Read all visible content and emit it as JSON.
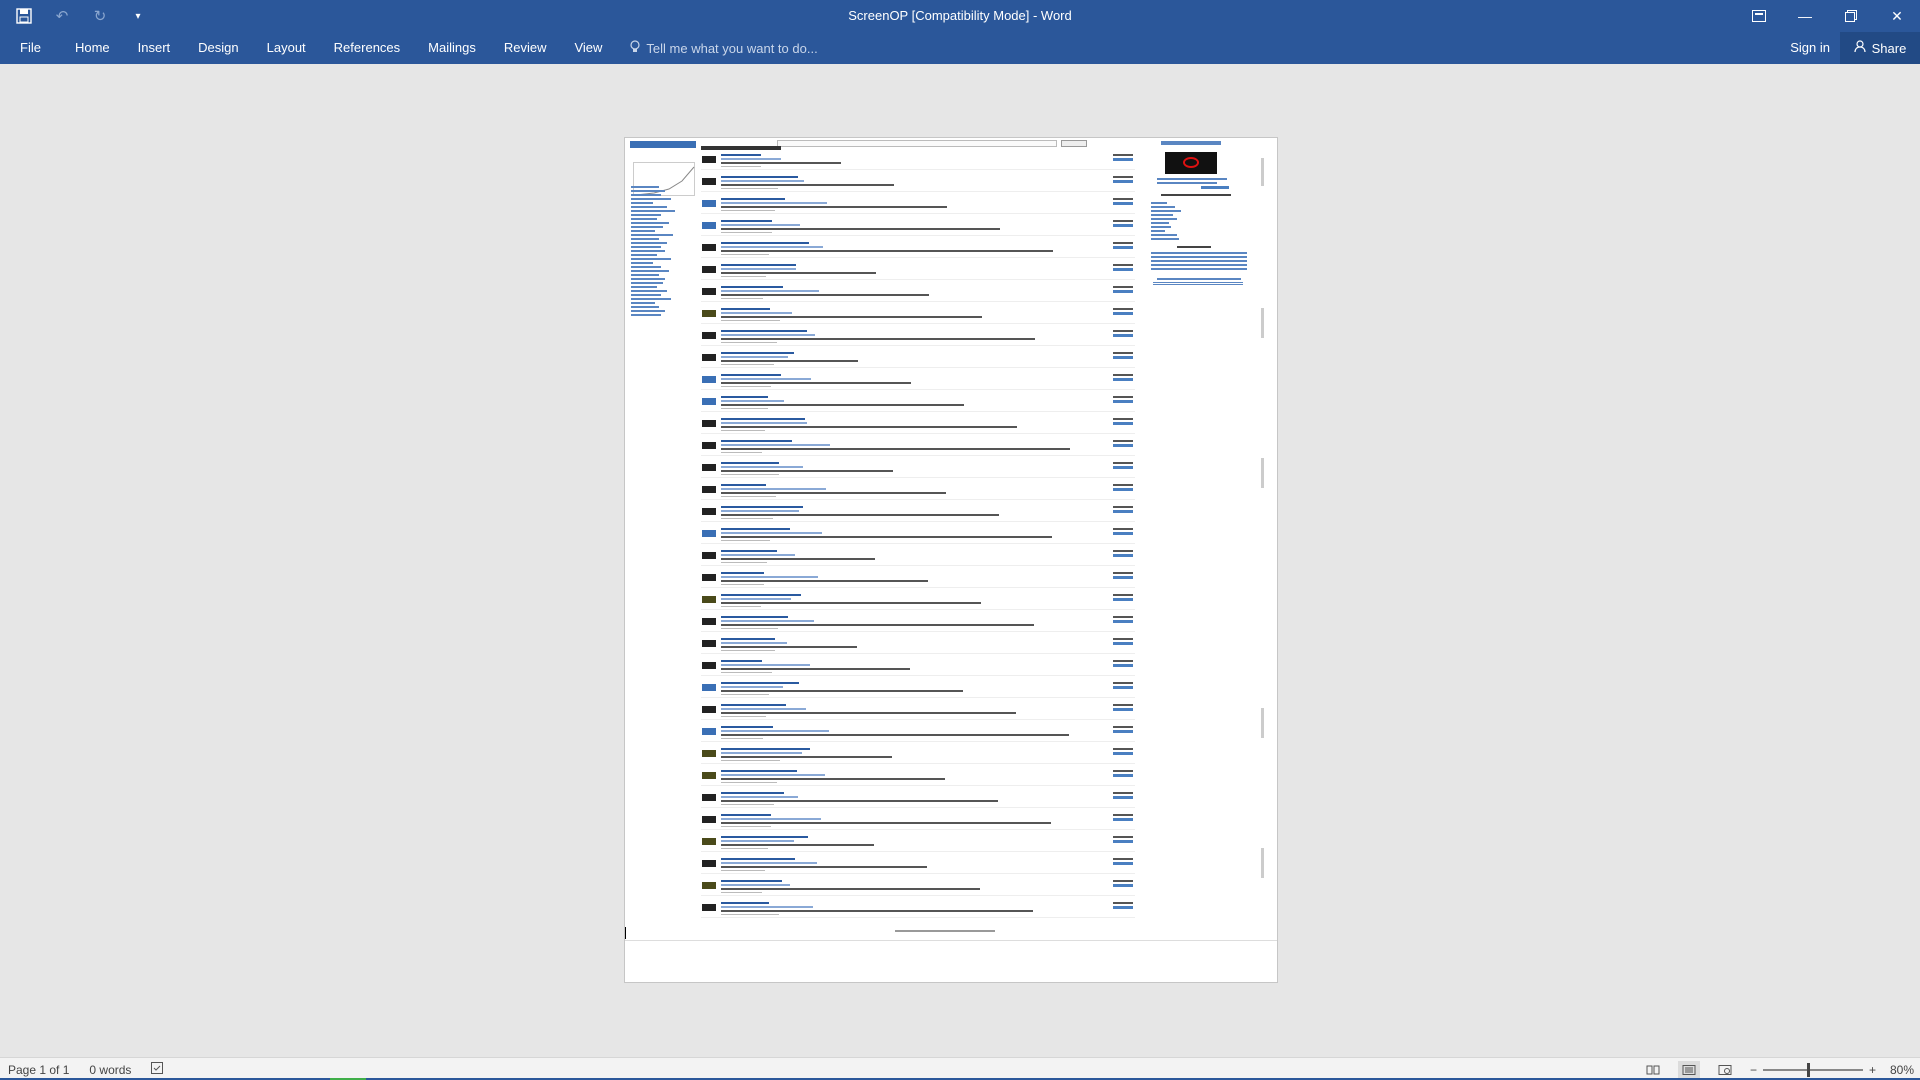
{
  "window": {
    "title": "ScreenOP [Compatibility Mode] - Word",
    "minimize_icon": "minimize-icon",
    "restore_icon": "restore-icon",
    "close_icon": "close-icon",
    "ribbon_display_icon": "ribbon-display-options-icon"
  },
  "quick_access": {
    "save_icon": "save-icon",
    "undo_icon": "undo-icon",
    "redo_icon": "redo-icon",
    "customize_icon": "customize-qat-icon"
  },
  "ribbon": {
    "tabs": [
      "File",
      "Home",
      "Insert",
      "Design",
      "Layout",
      "References",
      "Mailings",
      "Review",
      "View"
    ],
    "tell_me_placeholder": "Tell me what you want to do...",
    "sign_in": "Sign in",
    "share": "Share"
  },
  "status": {
    "page": "Page 1 of 1",
    "words": "0 words",
    "zoom": "80%",
    "zoom_value": 0.8
  },
  "colors": {
    "brand": "#2b579a",
    "canvas": "#e6e6e6"
  }
}
